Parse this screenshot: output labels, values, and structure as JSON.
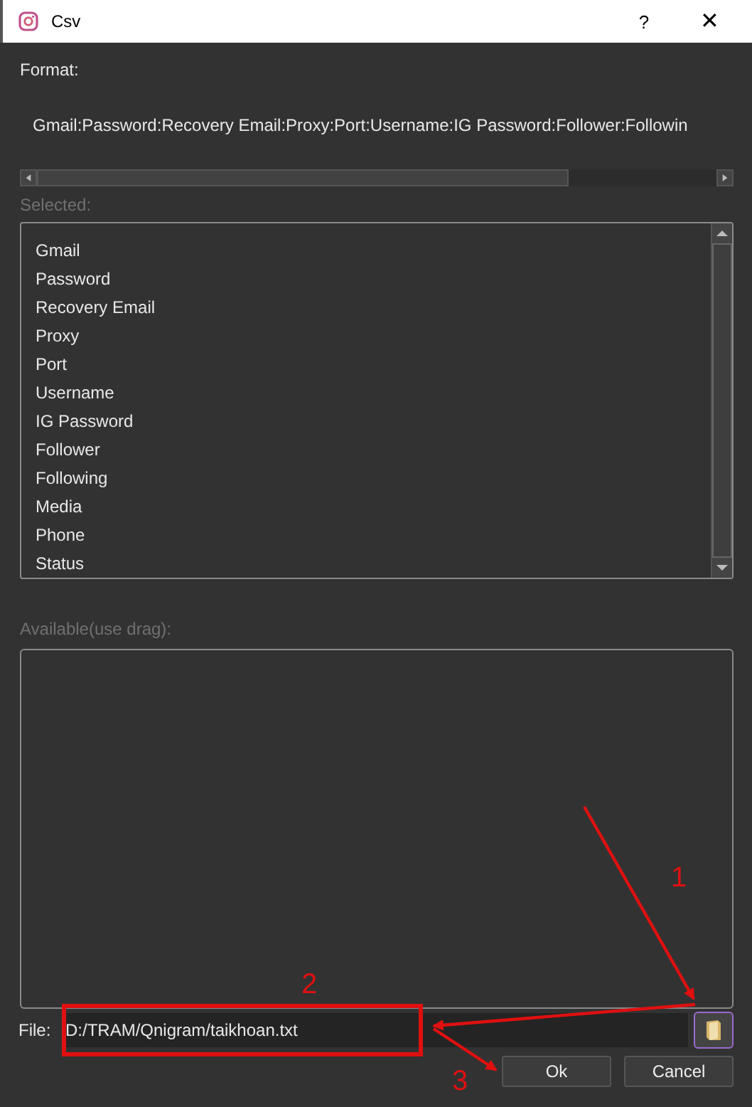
{
  "window": {
    "title": "Csv",
    "help": "?",
    "close": "✕"
  },
  "format": {
    "label": "Format:",
    "value": "Gmail:Password:Recovery Email:Proxy:Port:Username:IG Password:Follower:Followin"
  },
  "selected": {
    "label": "Selected:",
    "items": [
      "Gmail",
      "Password",
      "Recovery Email",
      "Proxy",
      "Port",
      "Username",
      "IG Password",
      "Follower",
      "Following",
      "Media",
      "Phone",
      "Status"
    ]
  },
  "available": {
    "label": "Available(use drag):"
  },
  "file": {
    "label": "File:",
    "value": "D:/TRAM/Qnigram/taikhoan.txt"
  },
  "buttons": [
    "Ok",
    "Cancel"
  ],
  "annotations": [
    "1",
    "2",
    "3"
  ]
}
